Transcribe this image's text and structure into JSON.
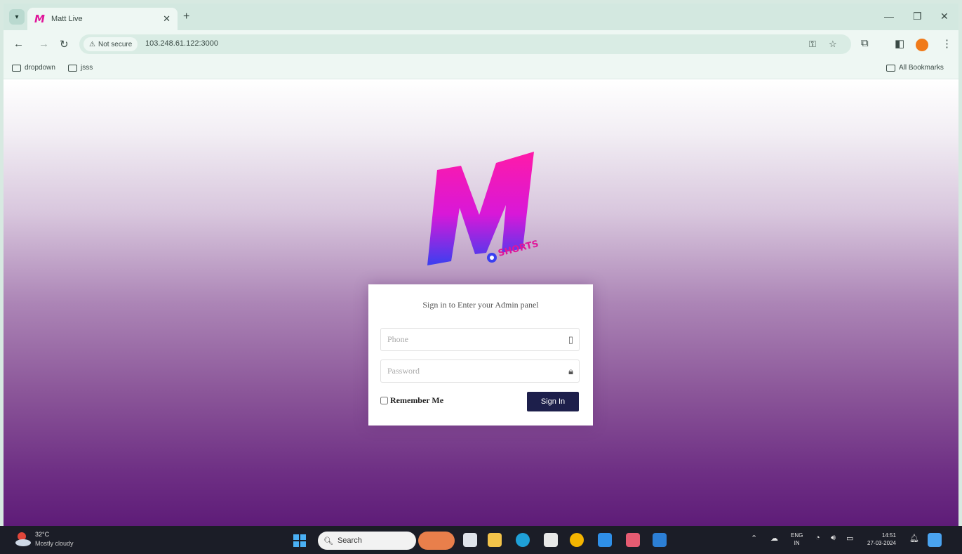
{
  "browser": {
    "tab_title": "Matt Live",
    "new_tab": "+",
    "security_label": "Not secure",
    "url": "103.248.61.122:3000",
    "bookmarks": [
      "dropdown",
      "jsss"
    ],
    "all_bookmarks": "All Bookmarks"
  },
  "logo": {
    "letter": "M",
    "word": "SHORTS"
  },
  "login": {
    "title": "Sign in to Enter your Admin panel",
    "phone_placeholder": "Phone",
    "password_placeholder": "Password",
    "remember_label": "Remember Me",
    "submit_label": "Sign In"
  },
  "taskbar": {
    "weather_temp": "32°C",
    "weather_desc": "Mostly cloudy",
    "search_placeholder": "Search",
    "lang_top": "ENG",
    "lang_bottom": "IN",
    "time": "14:51",
    "date": "27-03-2024"
  },
  "colors": {
    "button": "#1d1f4b",
    "logo_top": "#ff1aa8",
    "logo_bottom": "#3a3ff0",
    "background_bottom": "#5e1c78"
  }
}
